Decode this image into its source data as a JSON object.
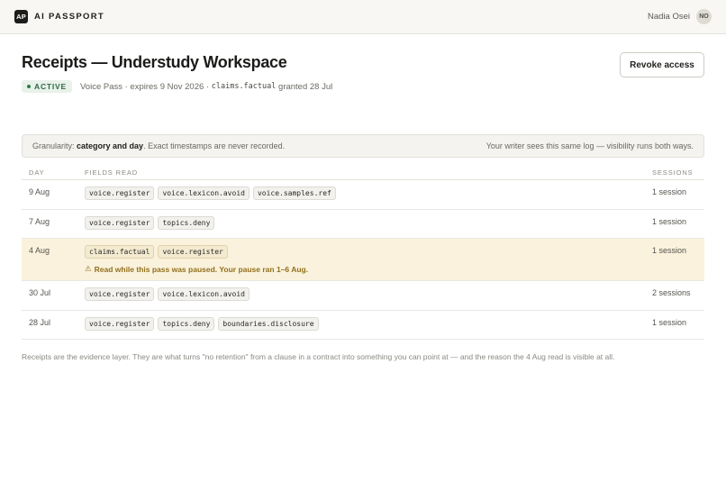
{
  "app": {
    "logo_text": "AP",
    "name": "AI PASSPORT"
  },
  "user": {
    "name": "Nadia Osei",
    "initials": "NO"
  },
  "page": {
    "title": "Receipts — Understudy Workspace",
    "status": "ACTIVE",
    "pass_info": "Voice Pass · expires 9 Nov 2026 · ",
    "grant_field": "claims.factual",
    "grant_suffix": " granted 28 Jul",
    "revoke_label": "Revoke access"
  },
  "banner": {
    "granularity_prefix": "Granularity: ",
    "granularity_value": "category and day",
    "granularity_suffix": ". Exact timestamps are never recorded.",
    "right_text": "Your writer sees this same log — visibility runs both ways."
  },
  "table": {
    "headers": {
      "day": "DAY",
      "fields": "FIELDS READ",
      "sessions": "SESSIONS"
    },
    "rows": [
      {
        "day": "9 Aug",
        "fields": [
          "voice.register",
          "voice.lexicon.avoid",
          "voice.samples.ref"
        ],
        "sessions": "1 session"
      },
      {
        "day": "7 Aug",
        "fields": [
          "voice.register",
          "topics.deny"
        ],
        "sessions": "1 session"
      },
      {
        "day": "4 Aug",
        "fields": [
          "claims.factual",
          "voice.register"
        ],
        "sessions": "1 session",
        "warning": "Read while this pass was paused. Your pause ran 1–6 Aug."
      },
      {
        "day": "30 Jul",
        "fields": [
          "voice.register",
          "voice.lexicon.avoid"
        ],
        "sessions": "2 sessions"
      },
      {
        "day": "28 Jul",
        "fields": [
          "voice.register",
          "topics.deny",
          "boundaries.disclosure"
        ],
        "sessions": "1 session"
      }
    ]
  },
  "footnote": "Receipts are the evidence layer. They are what turns \"no retention\" from a clause in a contract into something you can point at — and the reason the 4 Aug read is visible at all.",
  "colors": {
    "active_badge_bg": "#e8f1ea",
    "active_badge_text": "#2f6a43",
    "flagged_row_bg": "#faf2dc",
    "warning_text": "#93701d"
  }
}
